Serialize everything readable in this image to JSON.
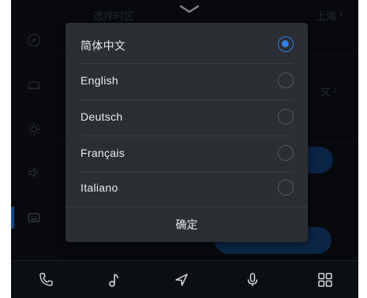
{
  "background": {
    "header_label": "选择时区",
    "header_value": "上海",
    "row2_value": "文"
  },
  "language_dialog": {
    "options": [
      {
        "label": "简体中文",
        "selected": true
      },
      {
        "label": "English",
        "selected": false
      },
      {
        "label": "Deutsch",
        "selected": false
      },
      {
        "label": "Français",
        "selected": false
      },
      {
        "label": "Italiano",
        "selected": false
      }
    ],
    "confirm_label": "确定"
  },
  "colors": {
    "accent": "#2f7fe8",
    "dialog_bg": "#2b2e33",
    "screen_bg": "#0b0e13"
  },
  "bottom_bar": {
    "icons": [
      "phone-icon",
      "music-icon",
      "navigation-icon",
      "microphone-icon",
      "apps-grid-icon"
    ]
  }
}
